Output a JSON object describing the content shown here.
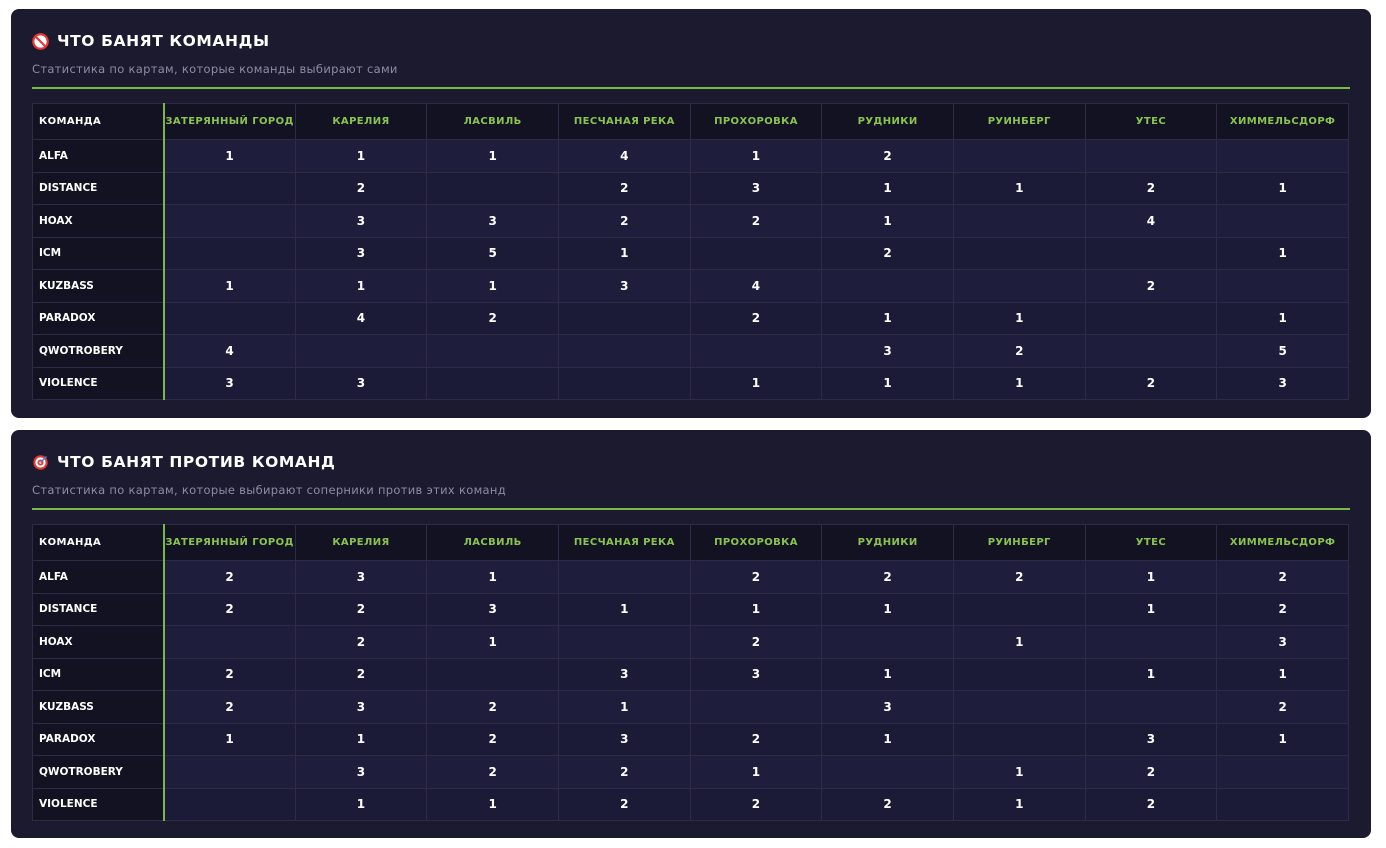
{
  "columns": [
    "КОМАНДА",
    "ЗАТЕРЯННЫЙ ГОРОД",
    "КАРЕЛИЯ",
    "ЛАСВИЛЬ",
    "ПЕСЧАНАЯ РЕКА",
    "ПРОХОРОВКА",
    "РУДНИКИ",
    "РУИНБЕРГ",
    "УТЕС",
    "ХИММЕЛЬСДОРФ"
  ],
  "colors": {
    "accent": "#8ac34f",
    "panel_bg": "#1c1a2e",
    "header_bg": "#131222",
    "row_bg": "#1e1d3c"
  },
  "panels": [
    {
      "icon": "no-entry-icon",
      "title": "ЧТО БАНЯТ КОМАНДЫ",
      "subtitle": "Статистика по картам, которые команды выбирают сами",
      "rows": [
        {
          "team": "ALFA",
          "values": [
            "1",
            "1",
            "1",
            "4",
            "1",
            "2",
            "",
            "",
            ""
          ]
        },
        {
          "team": "DISTANCE",
          "values": [
            "",
            "2",
            "",
            "2",
            "3",
            "1",
            "1",
            "2",
            "1"
          ]
        },
        {
          "team": "HOAX",
          "values": [
            "",
            "3",
            "3",
            "2",
            "2",
            "1",
            "",
            "4",
            ""
          ]
        },
        {
          "team": "ICM",
          "values": [
            "",
            "3",
            "5",
            "1",
            "",
            "2",
            "",
            "",
            "1"
          ]
        },
        {
          "team": "KUZBASS",
          "values": [
            "1",
            "1",
            "1",
            "3",
            "4",
            "",
            "",
            "2",
            ""
          ]
        },
        {
          "team": "PARADOX",
          "values": [
            "",
            "4",
            "2",
            "",
            "2",
            "1",
            "1",
            "",
            "1"
          ]
        },
        {
          "team": "QWOTROBERY",
          "values": [
            "4",
            "",
            "",
            "",
            "",
            "3",
            "2",
            "",
            "5"
          ]
        },
        {
          "team": "VIOLENCE",
          "values": [
            "3",
            "3",
            "",
            "",
            "1",
            "1",
            "1",
            "2",
            "3"
          ]
        }
      ]
    },
    {
      "icon": "target-icon",
      "title": "ЧТО БАНЯТ ПРОТИВ КОМАНД",
      "subtitle": "Статистика по картам, которые выбирают соперники против этих команд",
      "rows": [
        {
          "team": "ALFA",
          "values": [
            "2",
            "3",
            "1",
            "",
            "2",
            "2",
            "2",
            "1",
            "2"
          ]
        },
        {
          "team": "DISTANCE",
          "values": [
            "2",
            "2",
            "3",
            "1",
            "1",
            "1",
            "",
            "1",
            "2"
          ]
        },
        {
          "team": "HOAX",
          "values": [
            "",
            "2",
            "1",
            "",
            "2",
            "",
            "1",
            "",
            "3"
          ]
        },
        {
          "team": "ICM",
          "values": [
            "2",
            "2",
            "",
            "3",
            "3",
            "1",
            "",
            "1",
            "1"
          ]
        },
        {
          "team": "KUZBASS",
          "values": [
            "2",
            "3",
            "2",
            "1",
            "",
            "3",
            "",
            "",
            "2"
          ]
        },
        {
          "team": "PARADOX",
          "values": [
            "1",
            "1",
            "2",
            "3",
            "2",
            "1",
            "",
            "3",
            "1"
          ]
        },
        {
          "team": "QWOTROBERY",
          "values": [
            "",
            "3",
            "2",
            "2",
            "1",
            "",
            "1",
            "2",
            ""
          ]
        },
        {
          "team": "VIOLENCE",
          "values": [
            "",
            "1",
            "1",
            "2",
            "2",
            "2",
            "1",
            "2",
            ""
          ]
        }
      ]
    }
  ]
}
